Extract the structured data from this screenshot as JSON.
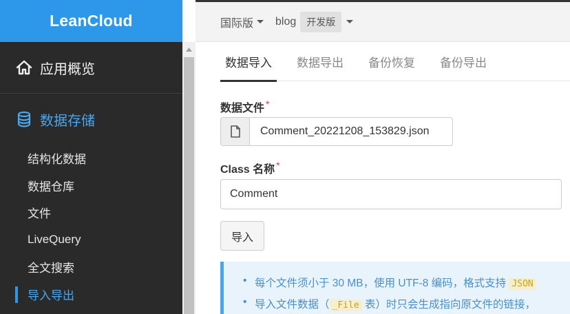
{
  "sidebar": {
    "logo": "LeanCloud",
    "overview_label": "应用概览",
    "storage_label": "数据存储",
    "items": [
      {
        "label": "结构化数据"
      },
      {
        "label": "数据仓库"
      },
      {
        "label": "文件"
      },
      {
        "label": "LiveQuery"
      },
      {
        "label": "全文搜索"
      },
      {
        "label": "导入导出",
        "active": true
      }
    ]
  },
  "topbar": {
    "region": "国际版",
    "app_name": "blog",
    "env_badge": "开发版"
  },
  "tabs": [
    {
      "label": "数据导入",
      "active": true
    },
    {
      "label": "数据导出"
    },
    {
      "label": "备份恢复"
    },
    {
      "label": "备份导出"
    }
  ],
  "form": {
    "file_label": "数据文件",
    "file_name": "Comment_20221208_153829.json",
    "class_label": "Class 名称",
    "class_value": "Comment",
    "required_mark": "*",
    "import_button": "导入"
  },
  "notice": {
    "line1_prefix": "每个文件须小于 30 MB，使用 UTF-8 编码，格式支持 ",
    "line1_code": "JSON",
    "line2_prefix": "导入文件数据（",
    "line2_code": "_File",
    "line2_suffix": " 表）时只会生成指向原文件的链接，"
  },
  "colors": {
    "brand_blue": "#2d97ea",
    "sidebar_bg": "#2a2a2a",
    "active_text": "#4aa6ee",
    "required": "#e53935"
  },
  "icons": {
    "overview": "home-icon",
    "storage": "database-icon",
    "file": "file-icon"
  }
}
